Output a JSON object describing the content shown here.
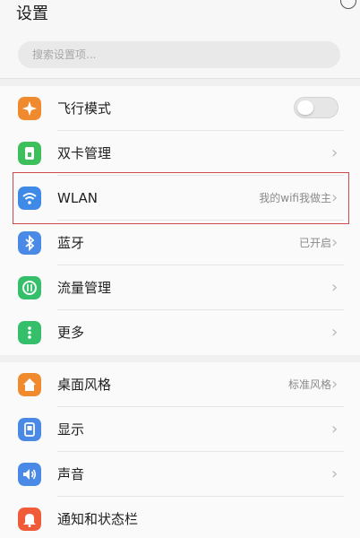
{
  "header": {
    "title": "设置",
    "icon": "close-icon"
  },
  "search": {
    "placeholder": "搜索设置项..."
  },
  "colors": {
    "accent": "#cf4a4a",
    "airplane": "#f08a2f",
    "sim": "#3dbf5b",
    "wlan": "#3e8ae6",
    "bluetooth": "#4a8ae6",
    "data": "#35bf6a",
    "more": "#35bf6a",
    "theme": "#f08a2f",
    "display": "#4a8ae6",
    "sound": "#4a8ae6",
    "notify": "#f05b3a"
  },
  "settings": {
    "group1": [
      {
        "label": "飞行模式",
        "icon": "airplane-icon",
        "toggle_on": false
      },
      {
        "label": "双卡管理",
        "icon": "sim-card-icon"
      },
      {
        "label": "WLAN",
        "icon": "wifi-icon",
        "value": "我的wifi我做主",
        "highlighted": true
      },
      {
        "label": "蓝牙",
        "icon": "bluetooth-icon",
        "value": "已开启"
      },
      {
        "label": "流量管理",
        "icon": "data-usage-icon"
      },
      {
        "label": "更多",
        "icon": "more-icon"
      }
    ],
    "group2": [
      {
        "label": "桌面风格",
        "icon": "home-icon",
        "value": "标准风格"
      },
      {
        "label": "显示",
        "icon": "display-icon"
      },
      {
        "label": "声音",
        "icon": "sound-icon"
      },
      {
        "label": "通知和状态栏",
        "icon": "bell-icon"
      }
    ]
  }
}
